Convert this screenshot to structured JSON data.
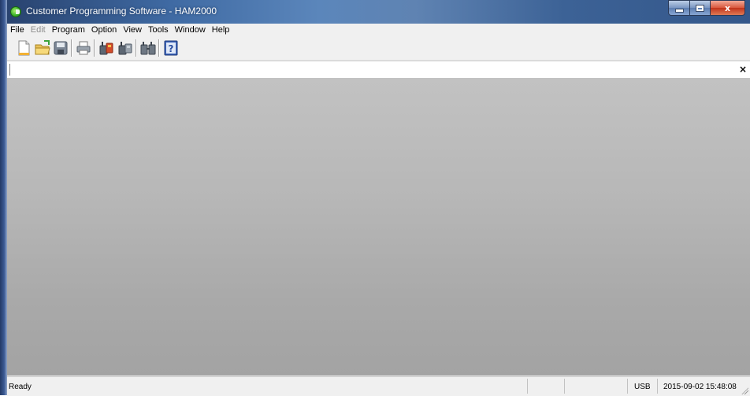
{
  "window": {
    "title": "Customer Programming Software - HAM2000",
    "caption_buttons": {
      "close_glyph": "x"
    }
  },
  "menu": {
    "items": [
      {
        "label": "File",
        "enabled": true
      },
      {
        "label": "Edit",
        "enabled": false
      },
      {
        "label": "Program",
        "enabled": true
      },
      {
        "label": "Option",
        "enabled": true
      },
      {
        "label": "View",
        "enabled": true
      },
      {
        "label": "Tools",
        "enabled": true
      },
      {
        "label": "Window",
        "enabled": true
      },
      {
        "label": "Help",
        "enabled": true
      }
    ]
  },
  "toolbar": {
    "buttons": [
      "new-file-icon",
      "open-folder-icon",
      "save-disk-icon",
      "print-icon",
      "read-radio-icon",
      "write-radio-icon",
      "clone-radio-icon",
      "help-icon"
    ]
  },
  "address_bar": {
    "close_glyph": "×"
  },
  "status": {
    "message": "Ready",
    "connection": "USB",
    "datetime": "2015-09-02 15:48:08"
  },
  "colors": {
    "titlebar": "#4a72a8",
    "client_area": "#b5b5b5",
    "close_button": "#d9583d"
  }
}
